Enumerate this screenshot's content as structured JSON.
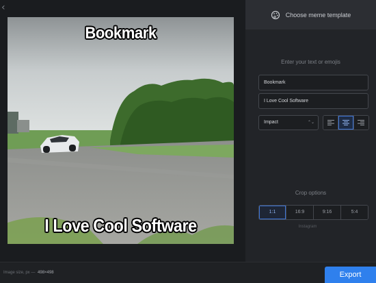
{
  "nav": {
    "back_glyph": "‹"
  },
  "meme": {
    "top_text": "Bookmark",
    "bottom_text": "I Love Cool Software"
  },
  "sidebar": {
    "template_button": "Choose meme template",
    "text_prompt": "Enter your text or emojis",
    "text_fields": [
      "Bookmark",
      "I Love Cool Software"
    ],
    "font": "Impact",
    "alignment": {
      "options": [
        "left",
        "center",
        "right"
      ],
      "selected": "center"
    },
    "crop": {
      "label": "Crop options",
      "options": [
        "1:1",
        "16:9",
        "9:16",
        "5:4"
      ],
      "selected": "1:1",
      "sub_label": "Instagram"
    }
  },
  "footer": {
    "image_size_label": "Image size, px —",
    "image_size_value": "498×498",
    "export_label": "Export"
  },
  "colors": {
    "accent": "#2f80ed",
    "panel": "#222428",
    "background": "#1a1c1f"
  },
  "icons": [
    "chevron-left-icon",
    "palette-icon",
    "align-left-icon",
    "align-center-icon",
    "align-right-icon",
    "select-arrows-icon"
  ]
}
